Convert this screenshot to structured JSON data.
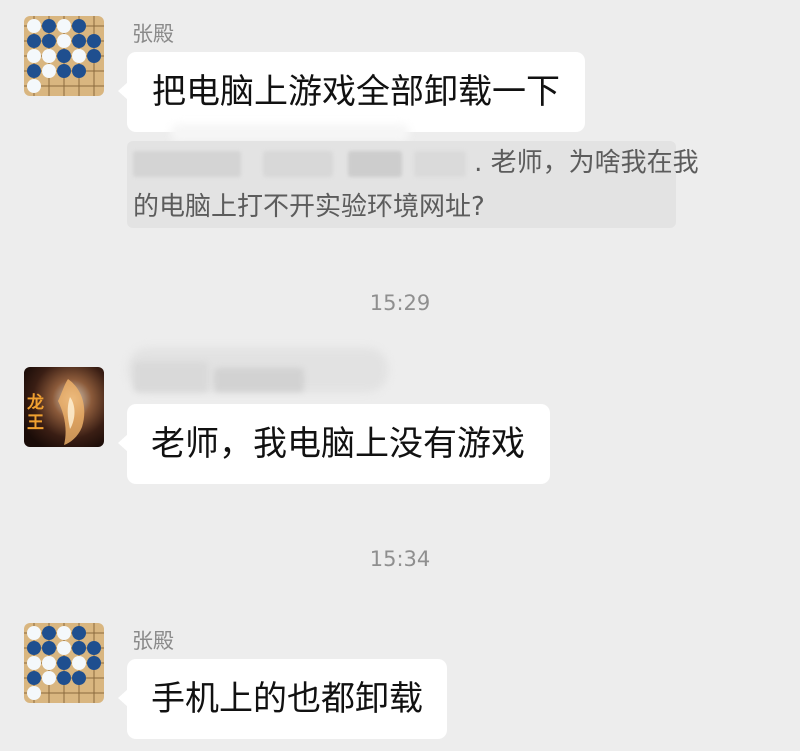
{
  "messages": [
    {
      "sender": "张殿",
      "avatar": "go-board-avatar",
      "text": "把电脑上游戏全部卸载一下",
      "quote": {
        "line1": ". 老师，为啥我在我",
        "line2": "的电脑上打不开实验环境网址?"
      }
    },
    {
      "avatar": "dragon-king-avatar",
      "avatar_caption": "龙王",
      "text": "老师，我电脑上没有游戏"
    },
    {
      "sender": "张殿",
      "avatar": "go-board-avatar",
      "text": "手机上的也都卸载"
    }
  ],
  "timestamps": [
    "15:29",
    "15:34"
  ],
  "colors": {
    "background": "#ededed",
    "bubble": "#ffffff",
    "quote_background": "#e3e3e3",
    "sender_name": "#8a8a8a",
    "timestamp": "#8f8f8f",
    "go_board": "#d9b680",
    "black_stone": "#1f4f8f",
    "white_stone": "#f4f8fb"
  }
}
